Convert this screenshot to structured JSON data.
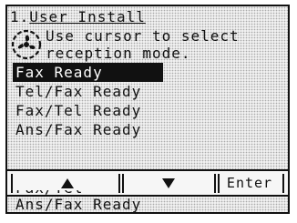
{
  "screen": {
    "title_prefix": "1.",
    "title": "User Install",
    "message_line1": "Use cursor to select",
    "message_line2": "reception mode."
  },
  "icon": {
    "name": "fan-info-icon"
  },
  "menu": {
    "items": [
      {
        "label": "Fax Ready",
        "selected": true
      },
      {
        "label": "Tel/Fax Ready",
        "selected": false
      },
      {
        "label": "Fax/Tel Ready",
        "selected": false
      },
      {
        "label": "Ans/Fax Ready",
        "selected": false
      }
    ],
    "overflow_item": "Ans/Fax Ready"
  },
  "softkeys": {
    "up_icon": "up-arrow-icon",
    "down_icon": "down-arrow-icon",
    "enter_label": "Enter"
  },
  "colors": {
    "lcd_dots": "#aaaaaa",
    "ink": "#111111",
    "highlight_bg": "#111111",
    "highlight_fg": "#ffffff"
  }
}
